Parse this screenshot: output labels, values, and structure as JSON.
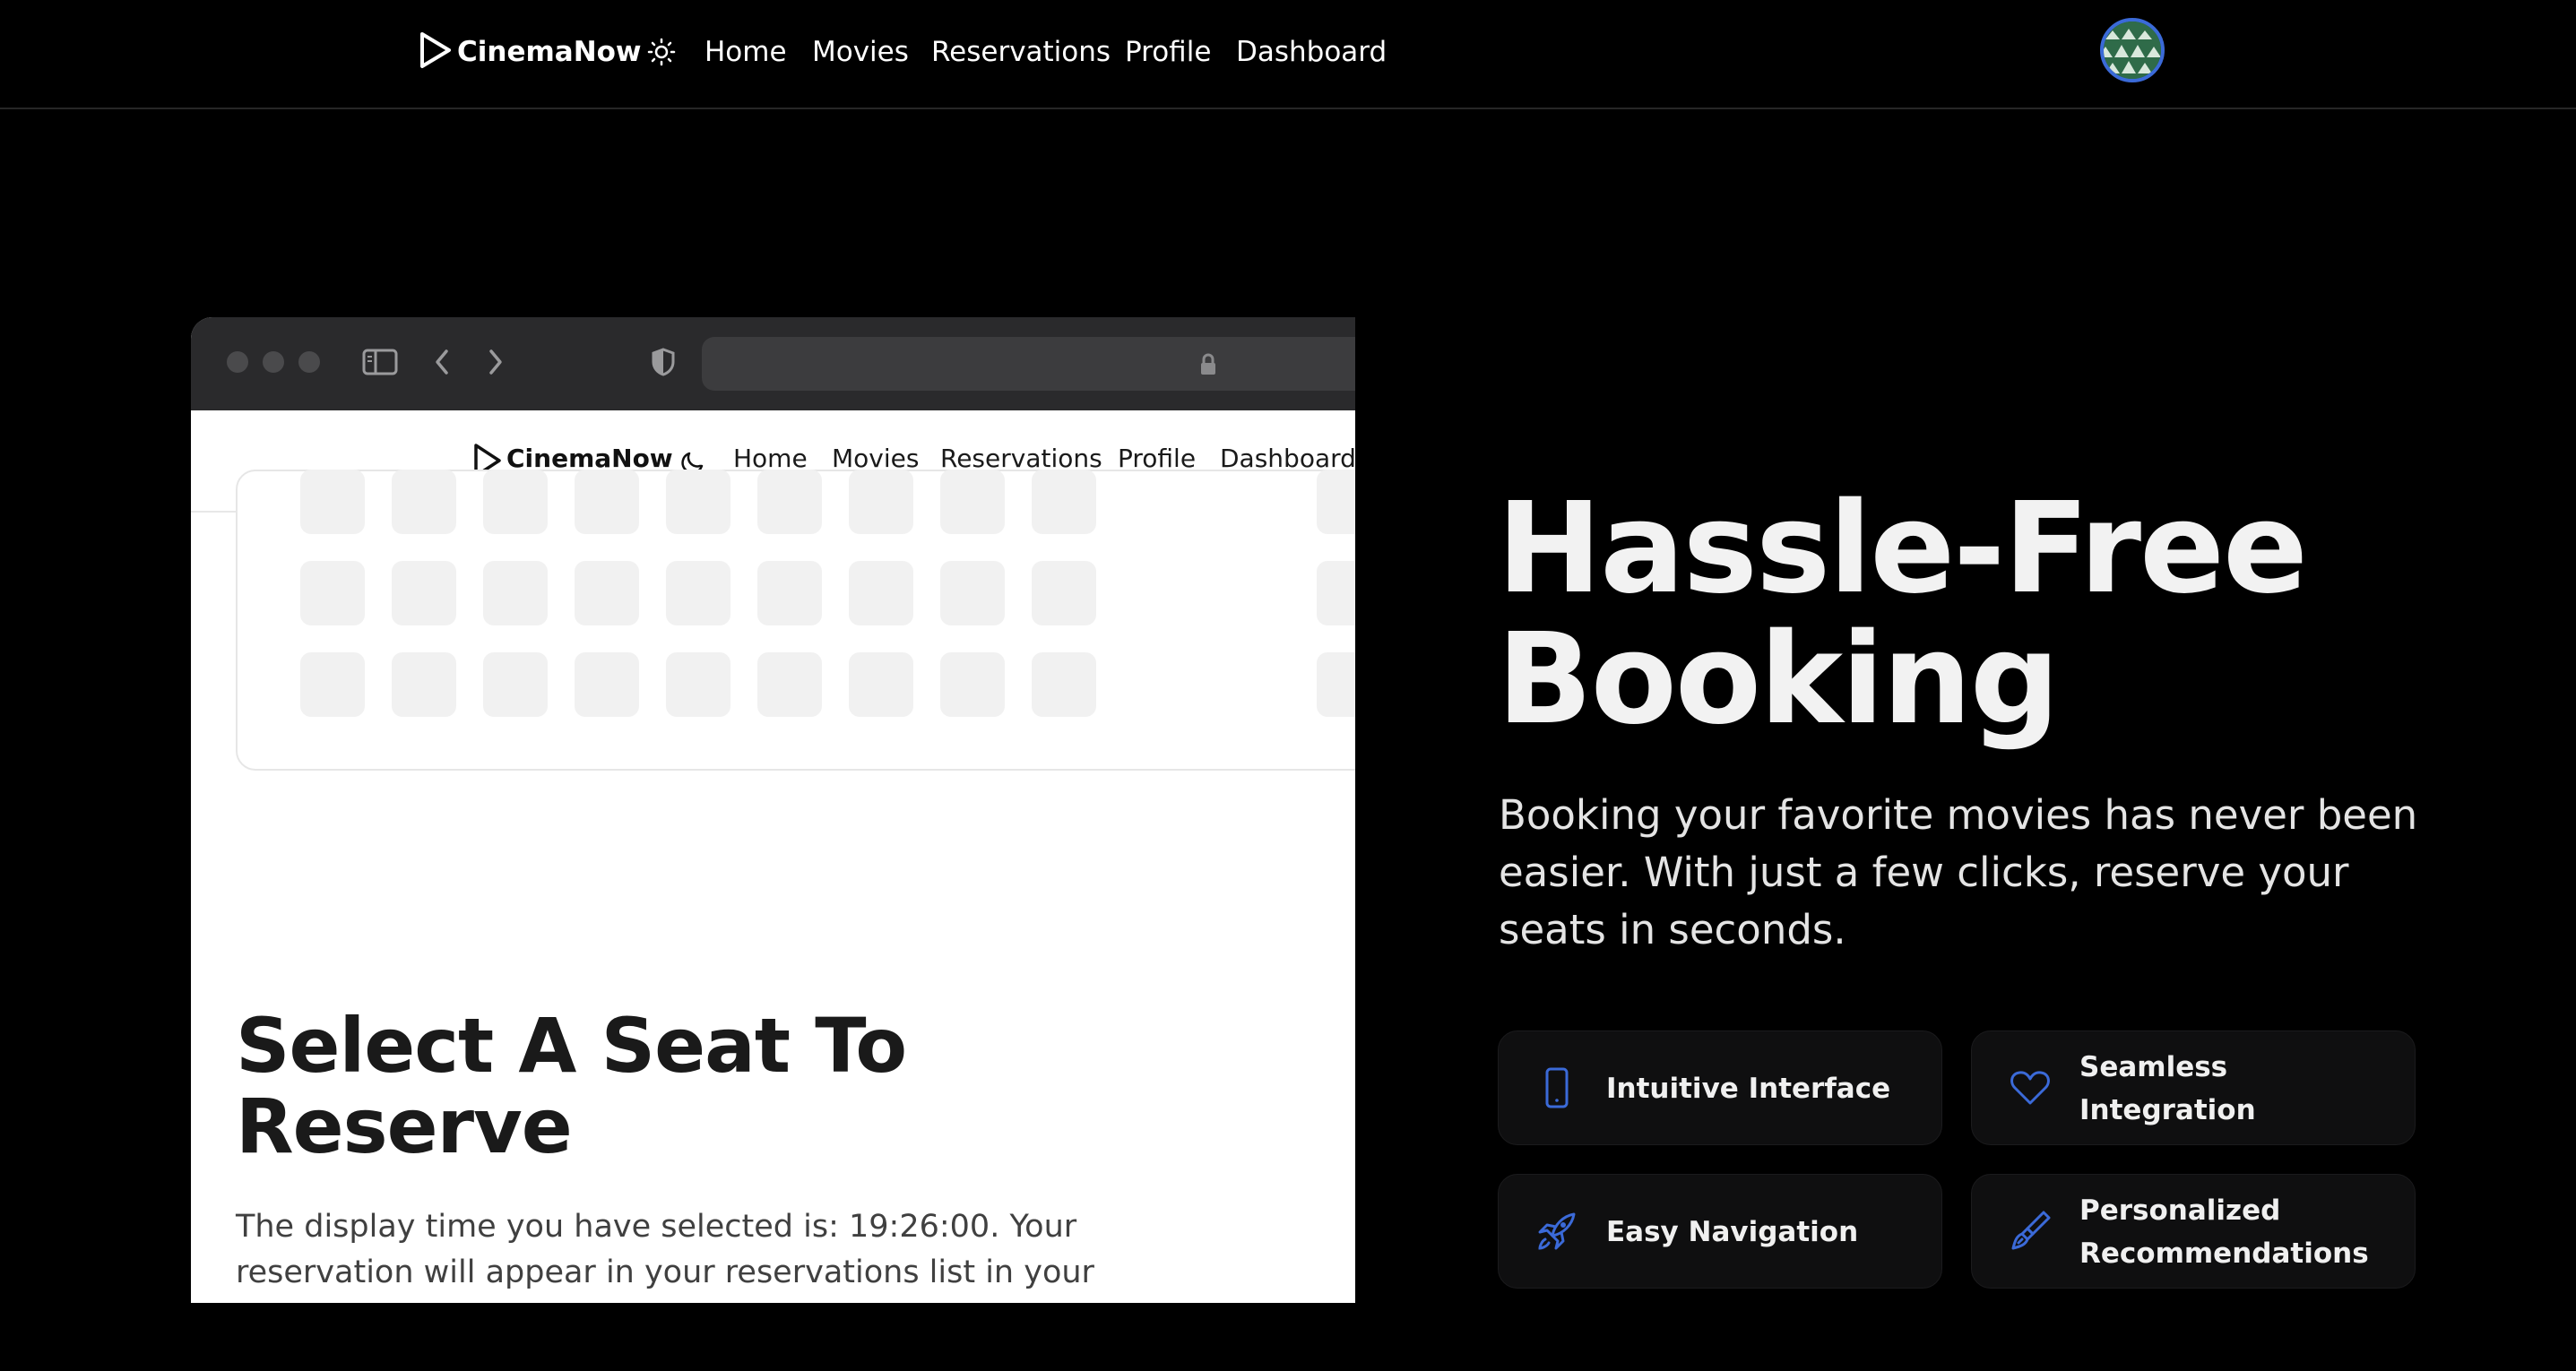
{
  "nav": {
    "brand": "CinemaNow",
    "links": [
      "Home",
      "Movies",
      "Reservations",
      "Profile",
      "Dashboard"
    ],
    "theme_icon": "sun-icon"
  },
  "mockup": {
    "nav": {
      "brand": "CinemaNow",
      "links": [
        "Home",
        "Movies",
        "Reservations",
        "Profile",
        "Dashboard"
      ],
      "theme_icon": "moon-icon"
    },
    "heading": "Select A Seat To Reserve",
    "description": "The display time you have selected is: 19:26:00. Your reservation will appear in your reservations list in your"
  },
  "hero": {
    "title": "Hassle-Free Booking",
    "subtitle": "Booking your favorite movies has never been easier. With just a few clicks, reserve your seats in seconds."
  },
  "features": [
    {
      "label": "Intuitive Interface",
      "icon": "phone-icon"
    },
    {
      "label": "Seamless Integration",
      "icon": "heart-icon"
    },
    {
      "label": "Easy Navigation",
      "icon": "rocket-icon"
    },
    {
      "label": "Personalized Recommendations",
      "icon": "paintbrush-icon"
    }
  ],
  "colors": {
    "accent": "#3b6ad8",
    "background": "#000000"
  }
}
